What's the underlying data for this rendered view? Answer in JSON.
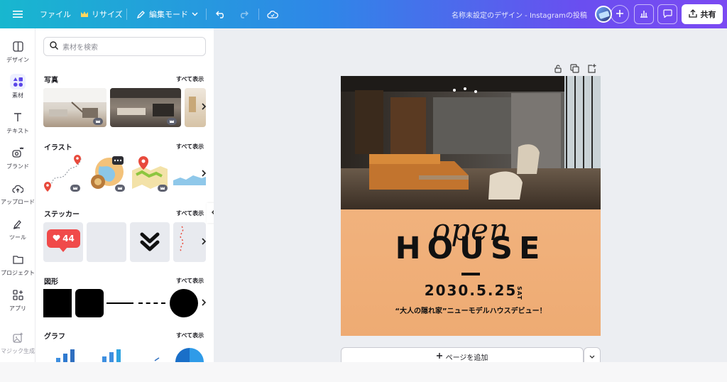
{
  "topbar": {
    "file": "ファイル",
    "resize": "リサイズ",
    "edit_mode": "編集モード",
    "doc_title": "名称未設定のデザイン - Instagramの投稿",
    "share": "共有"
  },
  "leftnav": {
    "items": [
      {
        "label": "デザイン",
        "icon": "layout-icon"
      },
      {
        "label": "素材",
        "icon": "elements-icon"
      },
      {
        "label": "テキスト",
        "icon": "text-icon"
      },
      {
        "label": "ブランド",
        "icon": "brand-icon"
      },
      {
        "label": "アップロード",
        "icon": "upload-icon"
      },
      {
        "label": "ツール",
        "icon": "draw-icon"
      },
      {
        "label": "プロジェクト",
        "icon": "folder-icon"
      },
      {
        "label": "アプリ",
        "icon": "apps-icon"
      },
      {
        "label": "マジック生成",
        "icon": "magic-icon"
      }
    ]
  },
  "panel": {
    "search_placeholder": "素材を検索",
    "see_all": "すべて表示",
    "sections": {
      "photos": "写真",
      "illust": "イラスト",
      "sticker": "ステッカー",
      "shapes": "図形",
      "graph": "グラフ"
    },
    "sticker_badge": "44"
  },
  "design": {
    "open": "open",
    "house": "HOUSE",
    "date": "2030.5.25",
    "day": "SAT",
    "tagline": "“大人の隠れ家”ニューモデルハウスデビュー！"
  },
  "canvas": {
    "add_page": "ページを追加"
  },
  "colors": {
    "accent": "#7b4af2",
    "kraft": "#efb07a"
  }
}
